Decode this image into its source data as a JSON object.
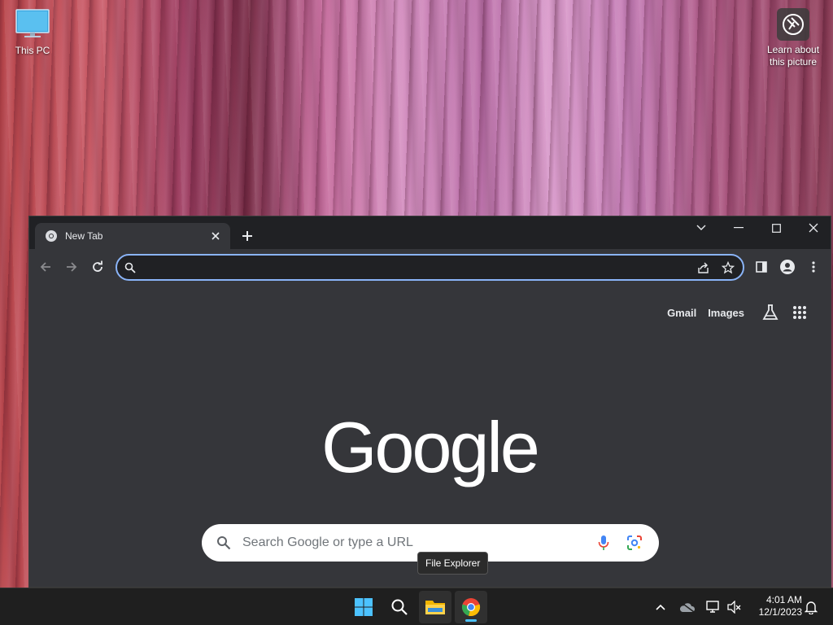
{
  "desktop": {
    "icons": [
      {
        "label": "This PC",
        "icon": "monitor-icon"
      },
      {
        "label": "Learn about this picture",
        "icon": "camera-icon"
      }
    ]
  },
  "browser": {
    "tab": {
      "title": "New Tab",
      "favicon": "chrome-icon"
    },
    "omnibox": {
      "value": "",
      "placeholder": ""
    },
    "toplinks": {
      "gmail": "Gmail",
      "images": "Images"
    },
    "logo": "Google",
    "search": {
      "placeholder": "Search Google or type a URL"
    }
  },
  "tooltip": "File Explorer",
  "taskbar": {
    "apps": [
      "start-icon",
      "search-icon",
      "file-explorer-icon",
      "chrome-icon"
    ],
    "clock": {
      "time": "4:01 AM",
      "date": "12/1/2023"
    }
  },
  "colors": {
    "accent": "#8ab4f8",
    "taskbar_indicator": "#4cc2ff",
    "window_bg": "#35363a"
  }
}
